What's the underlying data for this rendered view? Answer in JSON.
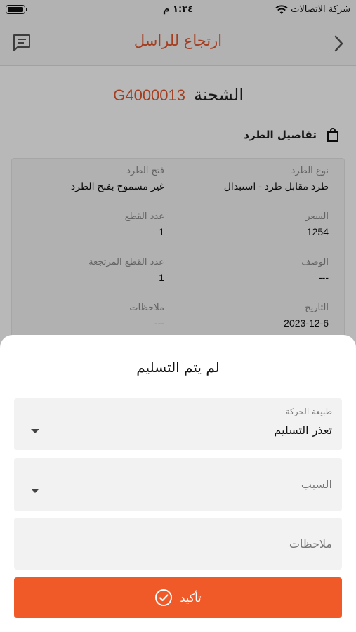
{
  "status_bar": {
    "carrier": "شركة الاتصالات",
    "time": "١:٣٤ م"
  },
  "header": {
    "title": "ارتجاع للراسل"
  },
  "shipment": {
    "label": "الشحنة",
    "code": "G4000013"
  },
  "section": {
    "title": "تفاصيل الطرد"
  },
  "details": {
    "parcel_type_label": "نوع الطرد",
    "parcel_type_value": "طرد مقابل طرد - استبدال",
    "parcel_open_label": "فتح الطرد",
    "parcel_open_value": "غير مسموح بفتح الطرد",
    "price_label": "السعر",
    "price_value": "1254",
    "pieces_label": "عدد القطع",
    "pieces_value": "1",
    "description_label": "الوصف",
    "description_value": "---",
    "returned_pieces_label": "عدد القطع المرتجعة",
    "returned_pieces_value": "1",
    "date_label": "التاريخ",
    "date_value": "2023-12-6",
    "notes_label": "ملاحظات",
    "notes_value": "---"
  },
  "sheet": {
    "title": "لم يتم التسليم",
    "movement_label": "طبيعة الحركة",
    "movement_value": "تعذر التسليم",
    "reason_placeholder": "السبب",
    "notes_placeholder": "ملاحظات",
    "confirm_label": "تأكيد"
  },
  "colors": {
    "accent": "#e4572e",
    "button": "#f05a28"
  }
}
